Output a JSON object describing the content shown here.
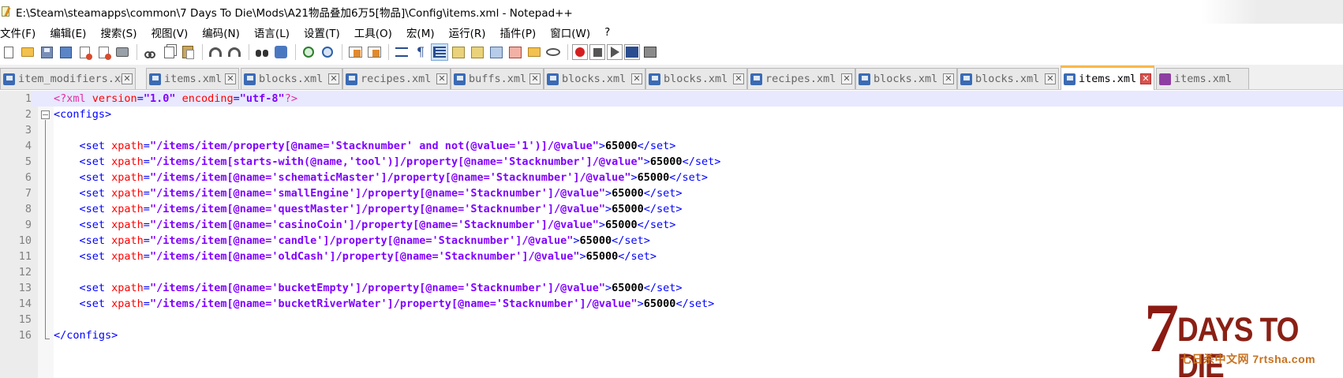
{
  "window": {
    "title": "E:\\Steam\\steamapps\\common\\7 Days To Die\\Mods\\A21物品叠加6万5[物品]\\Config\\items.xml - Notepad++"
  },
  "menu": {
    "items": [
      "文件(F)",
      "编辑(E)",
      "搜索(S)",
      "视图(V)",
      "编码(N)",
      "语言(L)",
      "设置(T)",
      "工具(O)",
      "宏(M)",
      "运行(R)",
      "插件(P)",
      "窗口(W)",
      "?"
    ]
  },
  "toolbar": {
    "icons": [
      "new-file",
      "open-file",
      "save",
      "save-all",
      "close",
      "close-all",
      "print",
      "cut",
      "copy",
      "paste",
      "undo",
      "redo",
      "find",
      "replace",
      "zoom-in",
      "zoom-out",
      "sync-vertical",
      "sync-horizontal",
      "word-wrap",
      "show-all-characters",
      "indent-guide",
      "user-defined-language",
      "document-map",
      "function-list",
      "folder-as-workspace",
      "monitoring",
      "record-macro",
      "stop-recording",
      "play-macro",
      "run-macro-multiple",
      "save-macro"
    ]
  },
  "tabs": [
    {
      "label": "item_modifiers.xml",
      "active": false
    },
    {
      "label": "items.xml",
      "active": false
    },
    {
      "label": "blocks.xml",
      "active": false
    },
    {
      "label": "recipes.xml",
      "active": false
    },
    {
      "label": "buffs.xml",
      "active": false
    },
    {
      "label": "blocks.xml",
      "active": false
    },
    {
      "label": "blocks.xml",
      "active": false
    },
    {
      "label": "recipes.xml",
      "active": false
    },
    {
      "label": "blocks.xml",
      "active": false
    },
    {
      "label": "blocks.xml",
      "active": false
    },
    {
      "label": "items.xml",
      "active": true
    },
    {
      "label": "items.xml",
      "active": false
    }
  ],
  "editor": {
    "current_line": 1,
    "lines": [
      {
        "n": "1",
        "tokens": [
          [
            "pi",
            "<?xml "
          ],
          [
            "attr",
            "version"
          ],
          [
            "tag",
            "="
          ],
          [
            "val",
            "\"1.0\""
          ],
          [
            "tag",
            " "
          ],
          [
            "attr",
            "encoding"
          ],
          [
            "tag",
            "="
          ],
          [
            "val",
            "\"utf-8\""
          ],
          [
            "pi",
            "?>"
          ]
        ]
      },
      {
        "n": "2",
        "tokens": [
          [
            "tag",
            "<configs>"
          ]
        ]
      },
      {
        "n": "3",
        "tokens": []
      },
      {
        "n": "4",
        "tokens": [
          [
            "txt",
            "    "
          ],
          [
            "tag",
            "<set "
          ],
          [
            "attr",
            "xpath"
          ],
          [
            "tag",
            "="
          ],
          [
            "val",
            "\"/items/item/property[@name='Stacknumber' and not(@value='1')]/@value\""
          ],
          [
            "tag",
            ">"
          ],
          [
            "txt",
            "65000"
          ],
          [
            "tag",
            "</set>"
          ]
        ]
      },
      {
        "n": "5",
        "tokens": [
          [
            "txt",
            "    "
          ],
          [
            "tag",
            "<set "
          ],
          [
            "attr",
            "xpath"
          ],
          [
            "tag",
            "="
          ],
          [
            "val",
            "\"/items/item[starts-with(@name,'tool')]/property[@name='Stacknumber']/@value\""
          ],
          [
            "tag",
            ">"
          ],
          [
            "txt",
            "65000"
          ],
          [
            "tag",
            "</set>"
          ]
        ]
      },
      {
        "n": "6",
        "tokens": [
          [
            "txt",
            "    "
          ],
          [
            "tag",
            "<set "
          ],
          [
            "attr",
            "xpath"
          ],
          [
            "tag",
            "="
          ],
          [
            "val",
            "\"/items/item[@name='schematicMaster']/property[@name='Stacknumber']/@value\""
          ],
          [
            "tag",
            ">"
          ],
          [
            "txt",
            "65000"
          ],
          [
            "tag",
            "</set>"
          ]
        ]
      },
      {
        "n": "7",
        "tokens": [
          [
            "txt",
            "    "
          ],
          [
            "tag",
            "<set "
          ],
          [
            "attr",
            "xpath"
          ],
          [
            "tag",
            "="
          ],
          [
            "val",
            "\"/items/item[@name='smallEngine']/property[@name='Stacknumber']/@value\""
          ],
          [
            "tag",
            ">"
          ],
          [
            "txt",
            "65000"
          ],
          [
            "tag",
            "</set>"
          ]
        ]
      },
      {
        "n": "8",
        "tokens": [
          [
            "txt",
            "    "
          ],
          [
            "tag",
            "<set "
          ],
          [
            "attr",
            "xpath"
          ],
          [
            "tag",
            "="
          ],
          [
            "val",
            "\"/items/item[@name='questMaster']/property[@name='Stacknumber']/@value\""
          ],
          [
            "tag",
            ">"
          ],
          [
            "txt",
            "65000"
          ],
          [
            "tag",
            "</set>"
          ]
        ]
      },
      {
        "n": "9",
        "tokens": [
          [
            "txt",
            "    "
          ],
          [
            "tag",
            "<set "
          ],
          [
            "attr",
            "xpath"
          ],
          [
            "tag",
            "="
          ],
          [
            "val",
            "\"/items/item[@name='casinoCoin']/property[@name='Stacknumber']/@value\""
          ],
          [
            "tag",
            ">"
          ],
          [
            "txt",
            "65000"
          ],
          [
            "tag",
            "</set>"
          ]
        ]
      },
      {
        "n": "10",
        "tokens": [
          [
            "txt",
            "    "
          ],
          [
            "tag",
            "<set "
          ],
          [
            "attr",
            "xpath"
          ],
          [
            "tag",
            "="
          ],
          [
            "val",
            "\"/items/item[@name='candle']/property[@name='Stacknumber']/@value\""
          ],
          [
            "tag",
            ">"
          ],
          [
            "txt",
            "65000"
          ],
          [
            "tag",
            "</set>"
          ]
        ]
      },
      {
        "n": "11",
        "tokens": [
          [
            "txt",
            "    "
          ],
          [
            "tag",
            "<set "
          ],
          [
            "attr",
            "xpath"
          ],
          [
            "tag",
            "="
          ],
          [
            "val",
            "\"/items/item[@name='oldCash']/property[@name='Stacknumber']/@value\""
          ],
          [
            "tag",
            ">"
          ],
          [
            "txt",
            "65000"
          ],
          [
            "tag",
            "</set>"
          ]
        ]
      },
      {
        "n": "12",
        "tokens": []
      },
      {
        "n": "13",
        "tokens": [
          [
            "txt",
            "    "
          ],
          [
            "tag",
            "<set "
          ],
          [
            "attr",
            "xpath"
          ],
          [
            "tag",
            "="
          ],
          [
            "val",
            "\"/items/item[@name='bucketEmpty']/property[@name='Stacknumber']/@value\""
          ],
          [
            "tag",
            ">"
          ],
          [
            "txt",
            "65000"
          ],
          [
            "tag",
            "</set>"
          ]
        ]
      },
      {
        "n": "14",
        "tokens": [
          [
            "txt",
            "    "
          ],
          [
            "tag",
            "<set "
          ],
          [
            "attr",
            "xpath"
          ],
          [
            "tag",
            "="
          ],
          [
            "val",
            "\"/items/item[@name='bucketRiverWater']/property[@name='Stacknumber']/@value\""
          ],
          [
            "tag",
            ">"
          ],
          [
            "txt",
            "65000"
          ],
          [
            "tag",
            "</set>"
          ]
        ]
      },
      {
        "n": "15",
        "tokens": []
      },
      {
        "n": "16",
        "tokens": [
          [
            "tag",
            "</configs>"
          ]
        ]
      }
    ]
  },
  "logo": {
    "seven": "7",
    "main": "DAYS TO DIE",
    "sub": "七日杀中文网 7rtsha.com"
  }
}
